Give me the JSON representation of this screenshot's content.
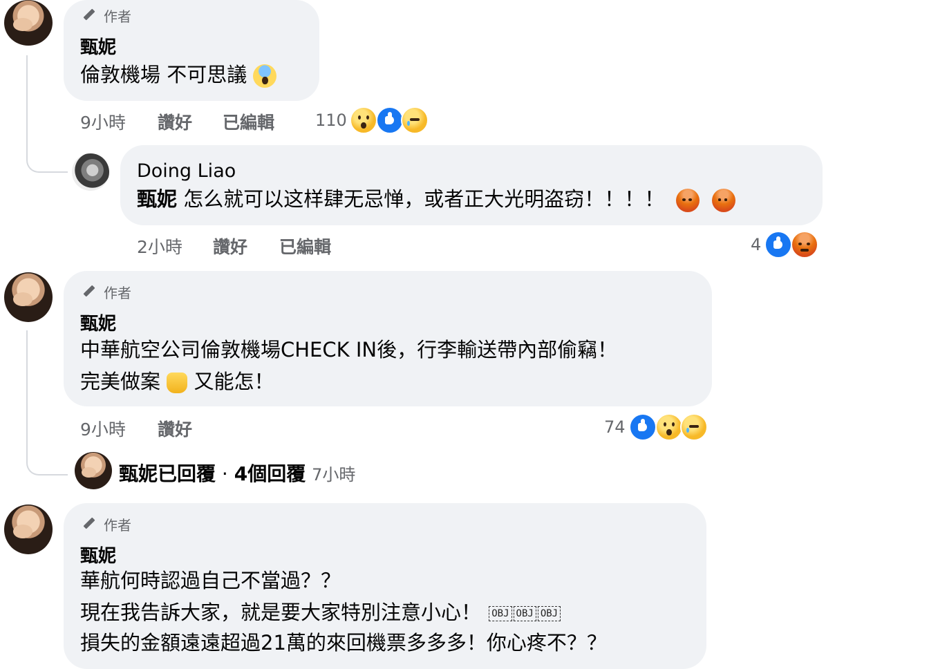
{
  "comments": [
    {
      "author_tag": "作者",
      "name": "甄妮",
      "lines": [
        "倫敦機場 不可思議"
      ],
      "inline_emoji": "face-screaming-in-fear",
      "meta": {
        "time": "9小時",
        "like": "讚好",
        "edited": "已編輯"
      },
      "reactions": {
        "count": "110",
        "types": [
          "wow",
          "like",
          "sad"
        ]
      }
    },
    {
      "name": "Doing Liao",
      "mention": "甄妮",
      "text": "怎么就可以这样肆无忌惮，或者正大光明盗窃！！！！",
      "inline_emoji": [
        "angry-face",
        "angry-face"
      ],
      "meta": {
        "time": "2小時",
        "like": "讚好",
        "edited": "已編輯"
      },
      "reactions": {
        "count": "4",
        "types": [
          "like",
          "angry"
        ]
      }
    },
    {
      "author_tag": "作者",
      "name": "甄妮",
      "lines": [
        "中華航空公司倫敦機場CHECK IN後，行李輸送帶內部偷竊！",
        "完美做案",
        "又能怎！"
      ],
      "inline_emoji": "thumbs-up",
      "meta": {
        "time": "9小時",
        "like": "讚好"
      },
      "reactions": {
        "count": "74",
        "types": [
          "like",
          "wow",
          "sad"
        ]
      },
      "replies": {
        "name": "甄妮已回覆",
        "count": "4個回覆",
        "time": "7小時",
        "separator": "·"
      }
    },
    {
      "author_tag": "作者",
      "name": "甄妮",
      "lines": [
        "華航何時認過自己不當過？？",
        "現在我告訴大家，就是要大家特別注意小心！",
        "損失的金額遠遠超過21萬的來回機票多多多！你心疼不？？"
      ],
      "obj_placeholders": [
        "OBJ",
        "OBJ",
        "OBJ"
      ]
    }
  ],
  "colors": {
    "bubble": "#f0f2f5",
    "meta_text": "#65676b",
    "like_blue": "#1877f2",
    "text": "#050505"
  }
}
